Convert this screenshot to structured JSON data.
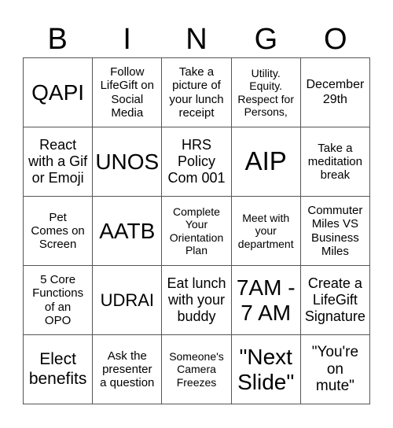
{
  "header": {
    "letters": [
      "B",
      "I",
      "N",
      "G",
      "O"
    ]
  },
  "board": {
    "rows": [
      [
        "QAPI",
        "Follow\nLifeGift on\nSocial\nMedia",
        "Take a\npicture of\nyour lunch\nreceipt",
        "Utility.\nEquity.\nRespect for\nPersons,",
        "December\n29th"
      ],
      [
        "React\nwith a Gif\nor Emoji",
        "UNOS",
        "HRS\nPolicy\nCom 001",
        "AIP",
        "Take a\nmeditation\nbreak"
      ],
      [
        "Pet\nComes on\nScreen",
        "AATB",
        "Complete\nYour\nOrientation\nPlan",
        "Meet with\nyour\ndepartment",
        "Commuter\nMiles VS\nBusiness\nMiles"
      ],
      [
        "5 Core\nFunctions\nof an\nOPO",
        "UDRAI",
        "Eat lunch\nwith your\nbuddy",
        "7AM -\n7 AM",
        "Create a\nLifeGift\nSignature"
      ],
      [
        "Elect\nbenefits",
        "Ask the\npresenter\na question",
        "Someone's\nCamera\nFreezes",
        "\"Next\nSlide\"",
        "\"You're\non\nmute\""
      ]
    ]
  }
}
